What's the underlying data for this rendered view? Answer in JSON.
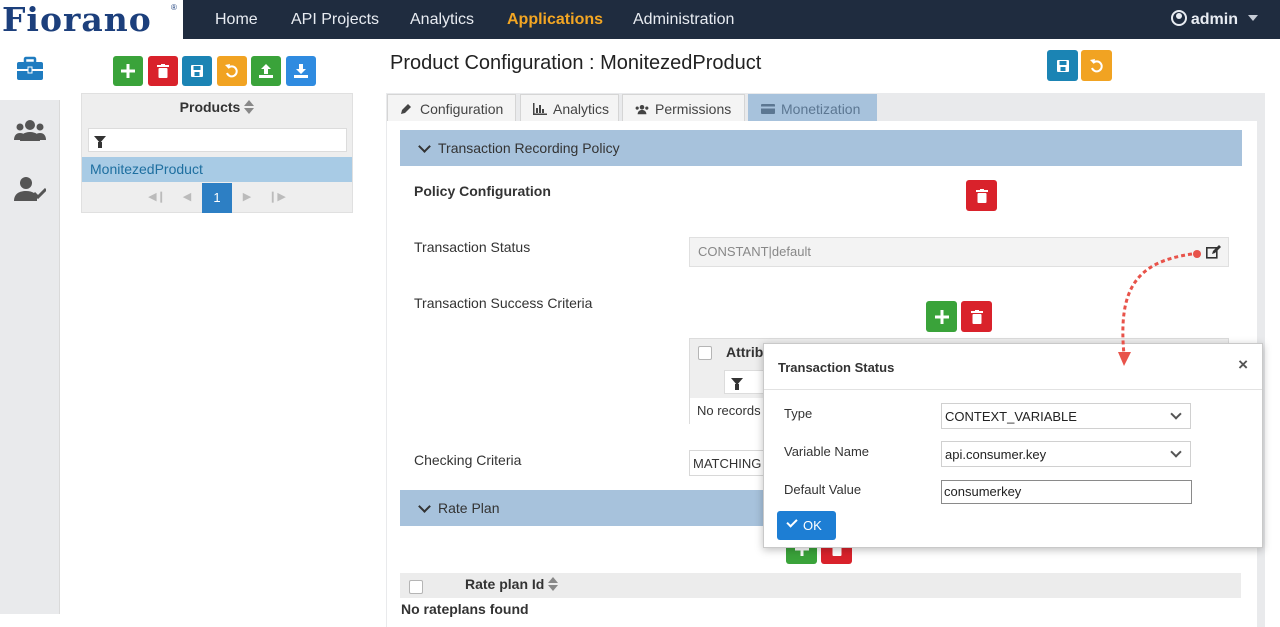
{
  "app": {
    "logo_text": "Fiorano",
    "logo_mark": "®"
  },
  "nav": {
    "items": [
      {
        "label": "Home"
      },
      {
        "label": "API Projects"
      },
      {
        "label": "Analytics"
      },
      {
        "label": "Applications",
        "active": true
      },
      {
        "label": "Administration"
      }
    ],
    "user": "admin"
  },
  "rail": {
    "icons": [
      "briefcase-icon",
      "users-icon",
      "user-check-icon"
    ]
  },
  "products": {
    "toolbar_icons": [
      "add-icon",
      "delete-icon",
      "save-icon",
      "refresh-icon",
      "upload-icon",
      "download-icon"
    ],
    "header": "Products",
    "rows": [
      "MonitezedProduct"
    ],
    "pager": {
      "current": "1"
    }
  },
  "main": {
    "title": "Product Configuration : MonitezedProduct",
    "tabs": [
      {
        "label": "Configuration",
        "icon": "pencil-icon"
      },
      {
        "label": "Analytics",
        "icon": "bar-chart-icon"
      },
      {
        "label": "Permissions",
        "icon": "users-icon"
      },
      {
        "label": "Monetization",
        "icon": "credit-card-icon",
        "active": true
      }
    ],
    "transaction_section": {
      "title": "Transaction Recording Policy",
      "policy_config_label": "Policy Configuration",
      "transaction_status_label": "Transaction Status",
      "transaction_status_value": "CONSTANT|default",
      "success_criteria_label": "Transaction Success Criteria",
      "grid_header_partial": "Attrib",
      "no_records_partial": "No records",
      "checking_criteria_label": "Checking Criteria",
      "checking_criteria_value": "MATCHING"
    },
    "rate_plan_section": {
      "title": "Rate Plan",
      "column": "Rate plan Id",
      "empty": "No rateplans found"
    }
  },
  "modal": {
    "title": "Transaction Status",
    "close": "×",
    "type_label": "Type",
    "type_value": "CONTEXT_VARIABLE",
    "var_label": "Variable Name",
    "var_value": "api.consumer.key",
    "default_label": "Default Value",
    "default_value": "consumerkey",
    "ok_label": "OK"
  },
  "colors": {
    "nav_bg": "#1f2c3f",
    "nav_active": "#f3a623",
    "section_header": "#a7c2dc",
    "green": "#3aa33a",
    "red": "#d9222b",
    "teal": "#1b84b4",
    "orange": "#f1a322",
    "primary": "#1d7ed4",
    "annotation_red": "#e8534a"
  }
}
